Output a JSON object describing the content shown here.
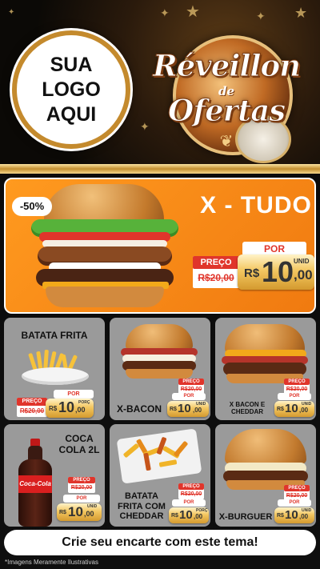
{
  "header": {
    "logo_lines": [
      "SUA",
      "LOGO",
      "AQUI"
    ],
    "title_line1": "Réveillon",
    "title_de": "de",
    "title_line2": "Ofertas"
  },
  "featured": {
    "discount": "-50%",
    "name": "X - TUDO",
    "por_label": "POR",
    "preco_label": "PREÇO",
    "old_price": "R$20,00",
    "currency": "R$",
    "price_int": "10",
    "price_cents": ",00",
    "unit": "UNID"
  },
  "products": [
    {
      "name": "BATATA FRITA",
      "preco_label": "PREÇO",
      "old_price": "R$20,00",
      "por_label": "POR",
      "currency": "R$",
      "price_int": "10",
      "price_cents": ",00",
      "unit": "PORÇ"
    },
    {
      "name": "X-BACON",
      "preco_label": "PREÇO",
      "old_price": "R$20,00",
      "por_label": "POR",
      "currency": "R$",
      "price_int": "10",
      "price_cents": ",00",
      "unit": "UNID"
    },
    {
      "name": "X BACON E CHEDDAR",
      "preco_label": "PREÇO",
      "old_price": "R$20,00",
      "por_label": "POR",
      "currency": "R$",
      "price_int": "10",
      "price_cents": ",00",
      "unit": "UNID"
    },
    {
      "name": "COCA COLA 2L",
      "preco_label": "PREÇO",
      "old_price": "R$20,00",
      "por_label": "POR",
      "currency": "R$",
      "price_int": "10",
      "price_cents": ",00",
      "unit": "UNID",
      "bottle_label": "Coca-Cola"
    },
    {
      "name": "BATATA FRITA COM CHEDDAR",
      "preco_label": "PREÇO",
      "old_price": "R$20,00",
      "por_label": "POR",
      "currency": "R$",
      "price_int": "10",
      "price_cents": ",00",
      "unit": "PORÇ"
    },
    {
      "name": "X-BURGUER",
      "preco_label": "PREÇO",
      "old_price": "R$20,00",
      "por_label": "POR",
      "currency": "R$",
      "price_int": "10",
      "price_cents": ",00",
      "unit": "UNID"
    }
  ],
  "cta": "Crie seu encarte com este tema!",
  "disclaimer": "*Imagens Meramente Ilustrativas",
  "colors": {
    "orange": "#f07a10",
    "red": "#e0352b",
    "gold": "#d49a2f",
    "card_gray": "#9a9a9a"
  }
}
